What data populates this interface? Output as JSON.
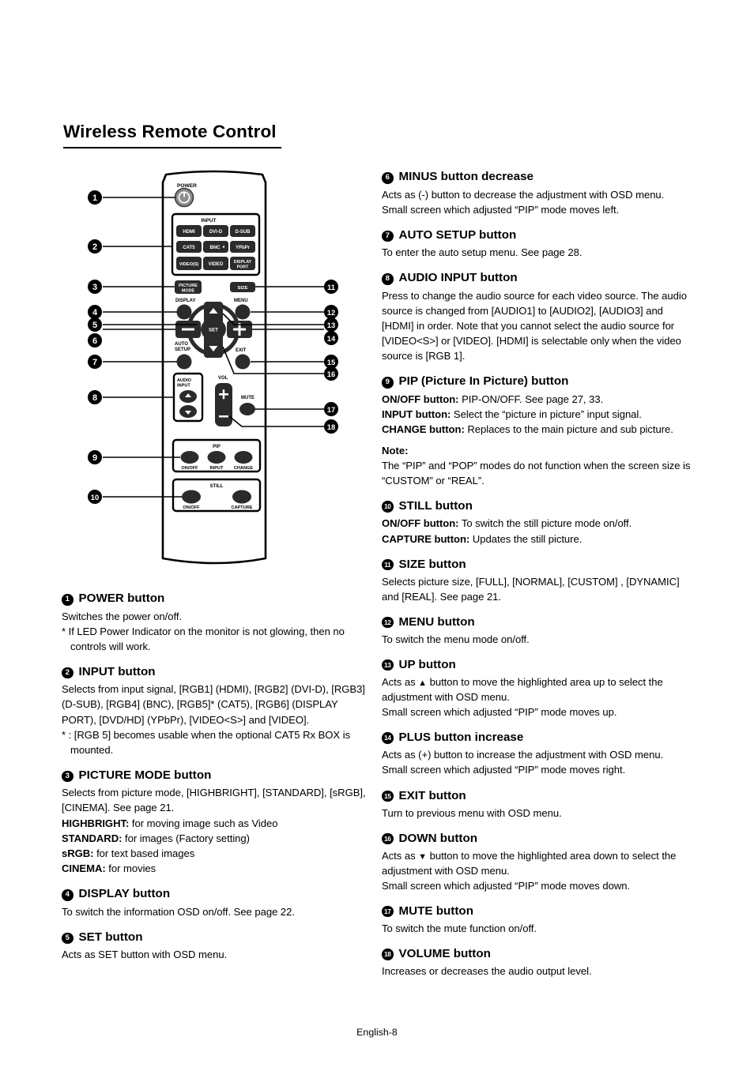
{
  "page": {
    "title": "Wireless Remote Control",
    "footer": "English-8"
  },
  "figure": {
    "label": "wireless-remote-control-diagram",
    "power_label": "POWER",
    "input_label": "INPUT",
    "input_buttons": [
      "HDMI",
      "DVI-D",
      "D-SUB",
      "CAT5",
      "BNC",
      "YPbPr",
      "VIDEO(S)",
      "VIDEO",
      "DISPLAY PORT"
    ],
    "picture_mode_label": "PICTURE MODE",
    "size_label": "SIZE",
    "display_label": "DISPLAY",
    "menu_label": "MENU",
    "set_label": "SET",
    "minus_label": "—",
    "plus_label": "+",
    "auto_setup_label": "AUTO SETUP",
    "exit_label": "EXIT",
    "audio_input_label": "AUDIO INPUT",
    "vol_label": "VOL",
    "mute_label": "MUTE",
    "pip_label": "PIP",
    "pip_buttons": [
      "ON/OFF",
      "INPUT",
      "CHANGE"
    ],
    "still_label": "STILL",
    "still_buttons": [
      "ON/OFF",
      "CAPTURE"
    ],
    "callouts_left": [
      "1",
      "2",
      "3",
      "4",
      "5",
      "6",
      "7",
      "8",
      "9",
      "10"
    ],
    "callouts_right": [
      "11",
      "12",
      "13",
      "14",
      "15",
      "16",
      "17",
      "18"
    ]
  },
  "left_column": {
    "s1": {
      "num": "1",
      "heading": "POWER button",
      "l1": "Switches the power on/off.",
      "l2": "* If LED Power Indicator on the monitor is not glowing, then no controls will work."
    },
    "s2": {
      "num": "2",
      "heading": "INPUT button",
      "l1": "Selects from input signal, [RGB1] (HDMI),  [RGB2] (DVI-D), [RGB3] (D-SUB),  [RGB4] (BNC), [RGB5]* (CAT5), [RGB6] (DISPLAY PORT), [DVD/HD] (YPbPr), [VIDEO<S>] and [VIDEO].",
      "l2": "* : [RGB 5] becomes usable when the optional CAT5 Rx BOX is mounted."
    },
    "s3": {
      "num": "3",
      "heading": "PICTURE MODE button",
      "l1": "Selects from picture mode, [HIGHBRIGHT],  [STANDARD], [sRGB], [CINEMA].  See page 21.",
      "t_highbright": "HIGHBRIGHT:",
      "d_highbright": " for moving image such as Video",
      "t_standard": "STANDARD:",
      "d_standard": " for images (Factory setting)",
      "t_srgb": "sRGB:",
      "d_srgb": " for text based images",
      "t_cinema": "CINEMA:",
      "d_cinema": " for movies"
    },
    "s4": {
      "num": "4",
      "heading": "DISPLAY button",
      "l1": "To switch the information OSD on/off.  See page 22."
    },
    "s5": {
      "num": "5",
      "heading": "SET button",
      "l1": "Acts as SET button with OSD menu."
    }
  },
  "right_column": {
    "s6": {
      "num": "6",
      "heading": "MINUS button decrease",
      "l1": "Acts as (-) button to decrease the adjustment with OSD menu.",
      "l2": "Small screen which adjusted “PIP” mode moves left."
    },
    "s7": {
      "num": "7",
      "heading": "AUTO SETUP button",
      "l1": "To enter the auto setup menu.  See page 28."
    },
    "s8": {
      "num": "8",
      "heading": "AUDIO INPUT button",
      "l1": "Press to change the audio source for each video source. The audio source is changed from [AUDIO1] to [AUDIO2], [AUDIO3] and [HDMI] in order. Note that you cannot select the audio source for [VIDEO<S>] or [VIDEO]. [HDMI] is selectable only when the video source is [RGB 1]."
    },
    "s9": {
      "num": "9",
      "heading": "PIP (Picture In Picture) button",
      "t_onoff": "ON/OFF button:",
      "d_onoff": " PIP-ON/OFF.  See page 27, 33.",
      "t_input": "INPUT button:",
      "d_input": " Select the “picture in picture” input signal.",
      "t_change": "CHANGE button:",
      "d_change": " Replaces to the main picture and sub picture.",
      "note_heading": "Note:",
      "note_text": "The “PIP” and “POP” modes do not function when the screen size is “CUSTOM” or “REAL”."
    },
    "s10": {
      "num": "10",
      "heading": "STILL button",
      "t_onoff": "ON/OFF button:",
      "d_onoff": " To switch the still picture mode on/off.",
      "t_capture": "CAPTURE button:",
      "d_capture": " Updates the still picture."
    },
    "s11": {
      "num": "11",
      "heading": "SIZE button",
      "l1": "Selects picture size, [FULL], [NORMAL], [CUSTOM] , [DYNAMIC] and [REAL]. See page 21."
    },
    "s12": {
      "num": "12",
      "heading": "MENU button",
      "l1": "To switch the menu mode on/off."
    },
    "s13": {
      "num": "13",
      "heading": "UP button",
      "l1a": "Acts as ",
      "l1b": " button to move the highlighted area up to select the adjustment with OSD menu.",
      "l2": "Small screen which adjusted “PIP” mode moves up."
    },
    "s14": {
      "num": "14",
      "heading": "PLUS button increase",
      "l1": "Acts as (+) button to increase the adjustment with OSD menu.",
      "l2": "Small screen which adjusted “PIP” mode moves right."
    },
    "s15": {
      "num": "15",
      "heading": "EXIT button",
      "l1": "Turn to previous menu with OSD menu."
    },
    "s16": {
      "num": "16",
      "heading": "DOWN button",
      "l1a": "Acts as ",
      "l1b": " button to move the highlighted area down to select the adjustment with OSD menu.",
      "l2": "Small screen which adjusted “PIP” mode moves down."
    },
    "s17": {
      "num": "17",
      "heading": "MUTE button",
      "l1": "To switch the mute function on/off."
    },
    "s18": {
      "num": "18",
      "heading": "VOLUME  button",
      "l1": "Increases or decreases the audio output level."
    }
  }
}
